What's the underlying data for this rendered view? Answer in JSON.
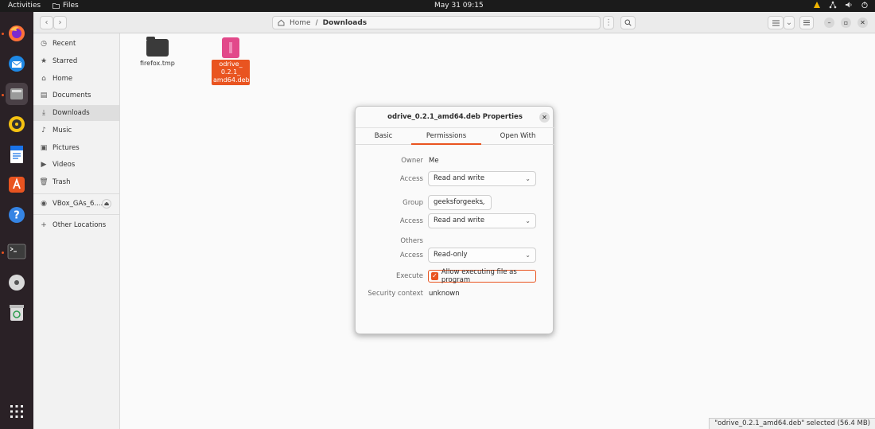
{
  "topbar": {
    "activities": "Activities",
    "app_name": "Files",
    "clock": "May 31  09:15"
  },
  "dock": {
    "apps": [
      {
        "name": "firefox",
        "icon": "firefox-icon"
      },
      {
        "name": "thunderbird",
        "icon": "thunderbird-icon"
      },
      {
        "name": "files",
        "icon": "files-icon"
      },
      {
        "name": "rhythmbox",
        "icon": "rhythmbox-icon"
      },
      {
        "name": "writer",
        "icon": "writer-icon"
      },
      {
        "name": "software",
        "icon": "software-icon"
      },
      {
        "name": "help",
        "icon": "help-icon"
      },
      {
        "name": "terminal",
        "icon": "terminal-icon"
      },
      {
        "name": "disc",
        "icon": "disc-icon"
      },
      {
        "name": "trash",
        "icon": "trash-icon"
      },
      {
        "name": "show-apps",
        "icon": "grid-icon"
      }
    ]
  },
  "pathbar": {
    "home": "Home",
    "separator": "/",
    "current": "Downloads"
  },
  "sidebar": {
    "items": [
      {
        "label": "Recent",
        "icon": "clock-icon"
      },
      {
        "label": "Starred",
        "icon": "star-icon"
      },
      {
        "label": "Home",
        "icon": "home-icon"
      },
      {
        "label": "Documents",
        "icon": "document-icon"
      },
      {
        "label": "Downloads",
        "icon": "download-icon"
      },
      {
        "label": "Music",
        "icon": "music-icon"
      },
      {
        "label": "Pictures",
        "icon": "picture-icon"
      },
      {
        "label": "Videos",
        "icon": "video-icon"
      },
      {
        "label": "Trash",
        "icon": "trash-icon"
      },
      {
        "label": "VBox_GAs_6....",
        "icon": "disc-icon"
      },
      {
        "label": "Other Locations",
        "icon": "plus-icon"
      }
    ]
  },
  "files": [
    {
      "name": "firefox.tmp"
    },
    {
      "name_lines": [
        "odrive_",
        "0.2.1_",
        "amd64.deb"
      ]
    }
  ],
  "status": "\"odrive_0.2.1_amd64.deb\" selected  (56.4 MB)",
  "dialog": {
    "title": "odrive_0.2.1_amd64.deb Properties",
    "tabs": [
      "Basic",
      "Permissions",
      "Open With"
    ],
    "owner_label": "Owner",
    "owner_value": "Me",
    "access_label": "Access",
    "owner_access": "Read and write",
    "group_label": "Group",
    "group_value": "geeksforgeeks",
    "group_access": "Read and write",
    "others_label": "Others",
    "others_access": "Read-only",
    "execute_label": "Execute",
    "execute_text": "Allow executing file as program",
    "execute_checked": true,
    "security_label": "Security context",
    "security_value": "unknown"
  },
  "colors": {
    "accent": "#e95420",
    "dock_bg": "#2a2126",
    "topbar_bg": "#1b1b1b"
  }
}
